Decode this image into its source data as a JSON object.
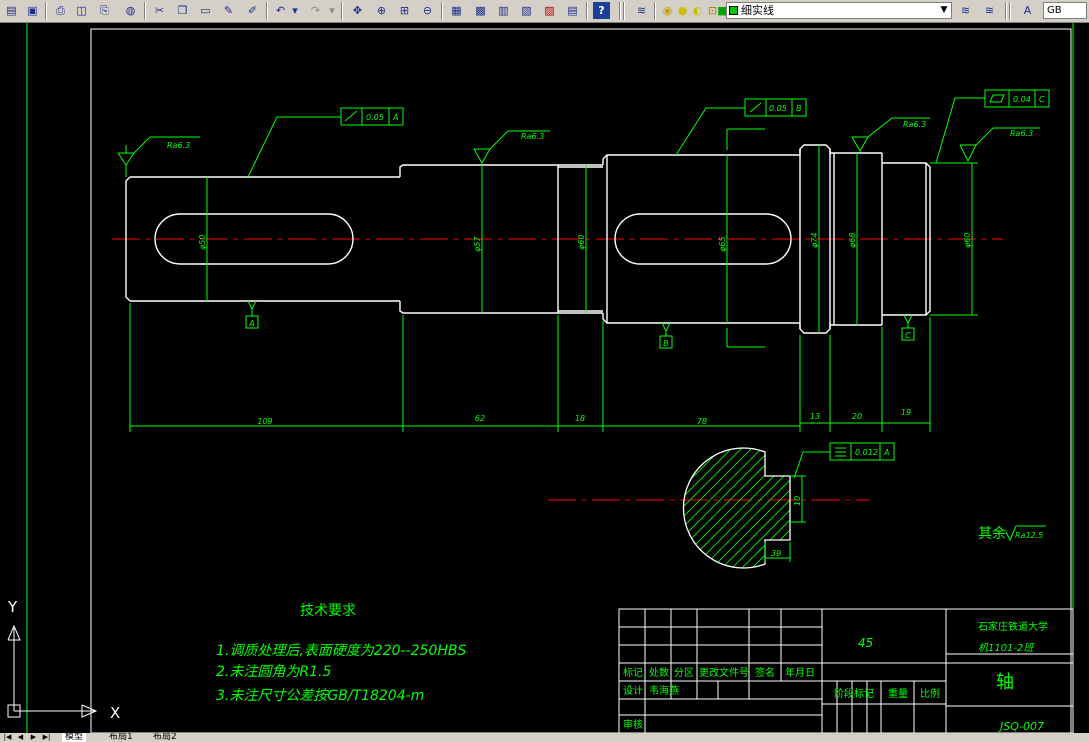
{
  "toolbar": {
    "layer_name": "细实线",
    "text_style": "GB"
  },
  "drawing": {
    "roughness": {
      "r1": "Ra6.3",
      "r2": "Ra6.3",
      "r3": "Ra6.3",
      "r4": "Ra6.3",
      "general_prefix": "其余",
      "general_value": "Ra12.5"
    },
    "gdt": {
      "f1_value": "0.05",
      "f1_datum": "A",
      "f2_value": "0.05",
      "f2_datum": "B",
      "f3_value": "0.04",
      "f3_datum": "C",
      "f4_value": "0.012",
      "f4_datum": "A"
    },
    "datums": {
      "a": "A",
      "b": "B",
      "c": "C"
    },
    "diameters": {
      "d1": "φ50",
      "d2": "φ57",
      "d3": "φ60",
      "d4": "φ65",
      "d5": "φ74",
      "d6": "φ68",
      "d7": "φ60"
    },
    "lengths": {
      "l1": "109",
      "l2": "62",
      "l3": "18",
      "l4": "78",
      "l5": "13",
      "l6": "20",
      "l7": "19"
    },
    "section": {
      "keyway_depth": "10",
      "keyway_width": "39"
    },
    "tech_req": {
      "title": "技术要求",
      "line1": "1.调质处理后,表面硬度为220--250HBS",
      "line2": "2.未注圆角为R1.5",
      "line3": "3.未注尺寸公差按GB/T18204-m"
    },
    "title_block": {
      "material": "45",
      "school": "石家庄铁道大学",
      "class_name": "机1101-2班",
      "part_name": "轴",
      "drawing_no": "JSQ-007",
      "h_mark": "标记",
      "h_count": "处数",
      "h_zone": "分区",
      "h_doc": "更改文件号",
      "h_sign": "签名",
      "h_date": "年月日",
      "h_design": "设计",
      "designer": "韦海燕",
      "h_review": "审核",
      "h_stage": "阶段标记",
      "h_weight": "重量",
      "h_scale": "比例"
    },
    "ucs": {
      "x": "X",
      "y": "Y"
    }
  },
  "tabs": {
    "model": "模型",
    "layout1": "布局1",
    "layout2": "布局2"
  },
  "colors": {
    "outline": "#00ff00",
    "center": "#ff0000",
    "text": "#00ff00",
    "frame": "#ffffff",
    "background": "#000000"
  }
}
